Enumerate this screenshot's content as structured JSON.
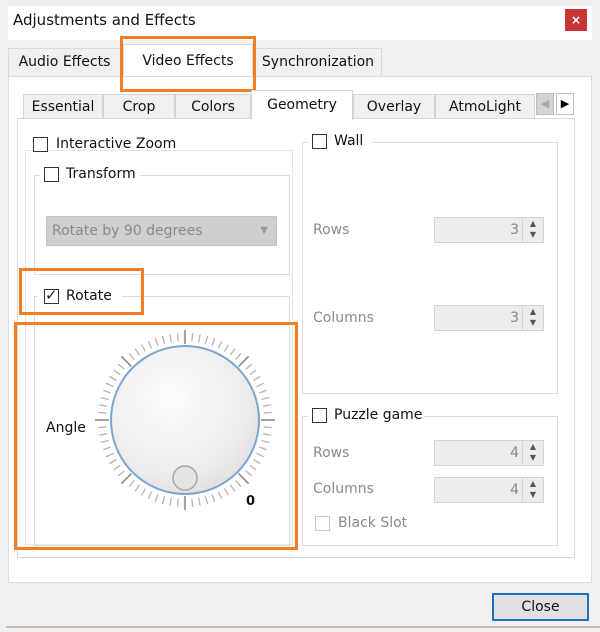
{
  "window": {
    "title": "Adjustments and Effects",
    "close_glyph": "×"
  },
  "main_tabs": [
    {
      "label": "Audio Effects",
      "active": false
    },
    {
      "label": "Video Effects",
      "active": true
    },
    {
      "label": "Synchronization",
      "active": false
    }
  ],
  "sub_tabs": [
    {
      "label": "Essential",
      "active": false
    },
    {
      "label": "Crop",
      "active": false
    },
    {
      "label": "Colors",
      "active": false
    },
    {
      "label": "Geometry",
      "active": true
    },
    {
      "label": "Overlay",
      "active": false
    },
    {
      "label": "AtmoLight",
      "active": false
    }
  ],
  "tab_scroll": {
    "left_glyph": "◀",
    "right_glyph": "▶"
  },
  "geometry": {
    "interactive_zoom": {
      "label": "Interactive Zoom",
      "checked": false
    },
    "transform": {
      "label": "Transform",
      "checked": false,
      "select_value": "Rotate by 90 degrees",
      "select_arrow": "▼"
    },
    "rotate": {
      "label": "Rotate",
      "checked": true,
      "check_glyph": "✓",
      "angle_label": "Angle",
      "angle_value": 0,
      "angle_value_text": "0"
    },
    "wall": {
      "label": "Wall",
      "checked": false,
      "rows_label": "Rows",
      "rows_value": "3",
      "columns_label": "Columns",
      "columns_value": "3"
    },
    "puzzle": {
      "label": "Puzzle game",
      "checked": false,
      "rows_label": "Rows",
      "rows_value": "4",
      "columns_label": "Columns",
      "columns_value": "4",
      "black_slot_label": "Black Slot",
      "black_slot_checked": false
    }
  },
  "spin_glyphs": {
    "up": "▲",
    "down": "▼"
  },
  "footer": {
    "close_label": "Close"
  },
  "highlight_color": "#f37d22",
  "close_button_color": "#c7343a"
}
